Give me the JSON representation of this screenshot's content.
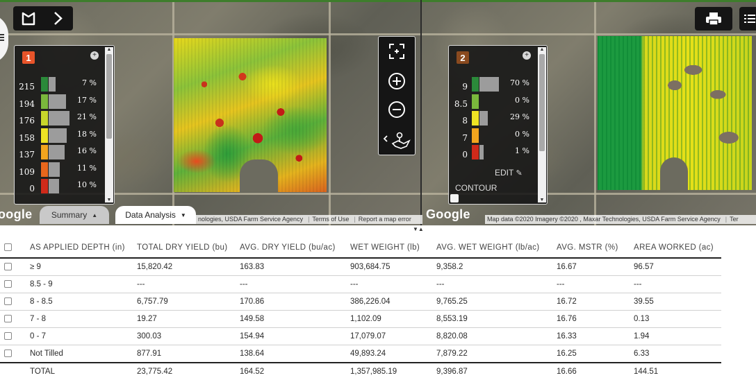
{
  "map_left": {
    "legend": {
      "badge": "1",
      "badge_color": "#e8542a",
      "rows": [
        {
          "label": "215",
          "pct": "7 %",
          "color": "#2b8a3a",
          "fraction": 0.07
        },
        {
          "label": "194",
          "pct": "17 %",
          "color": "#7ab83c",
          "fraction": 0.17
        },
        {
          "label": "176",
          "pct": "21 %",
          "color": "#c9d62b",
          "fraction": 0.21
        },
        {
          "label": "158",
          "pct": "18 %",
          "color": "#efe424",
          "fraction": 0.18
        },
        {
          "label": "137",
          "pct": "16 %",
          "color": "#f2a51e",
          "fraction": 0.16
        },
        {
          "label": "109",
          "pct": "11 %",
          "color": "#e9671c",
          "fraction": 0.11
        },
        {
          "label": "0",
          "pct": "10 %",
          "color": "#cf2a1a",
          "fraction": 0.1
        }
      ]
    },
    "google_label": "oogle",
    "tabs": {
      "summary": "Summary",
      "data_analysis": "Data Analysis"
    },
    "attribution": [
      "nologies, USDA Farm Service Agency",
      "Terms of Use",
      "Report a map error"
    ]
  },
  "map_right": {
    "legend": {
      "badge": "2",
      "badge_color": "#8a4a1f",
      "rows": [
        {
          "label": "9",
          "pct": "70 %",
          "color": "#2b8a3a",
          "fraction": 0.7
        },
        {
          "label": "8.5",
          "pct": "0 %",
          "color": "#7ab83c",
          "fraction": 0.0
        },
        {
          "label": "8",
          "pct": "29 %",
          "color": "#efe424",
          "fraction": 0.29
        },
        {
          "label": "7",
          "pct": "0 %",
          "color": "#f2a51e",
          "fraction": 0.0
        },
        {
          "label": "0",
          "pct": "1 %",
          "color": "#cf2a1a",
          "fraction": 0.01
        }
      ],
      "edit_label": "EDIT",
      "contour_label": "CONTOUR"
    },
    "google_label": "Google",
    "attribution": [
      "Map data ©2020 Imagery ©2020 , Maxar Technologies, USDA Farm Service Agency",
      "Ter"
    ]
  },
  "icons": {
    "field_icon": "field-outline-icon",
    "next_icon": "chevron-right-icon",
    "print_icon": "printer-icon",
    "list_icon": "list-icon",
    "fullscreen_icon": "fullscreen-icon",
    "zoom_in_icon": "zoom-in-icon",
    "zoom_out_icon": "zoom-out-icon",
    "layers_icon": "map-layers-icon"
  },
  "table": {
    "headers": [
      "AS APPLIED DEPTH (in)",
      "TOTAL DRY YIELD (bu)",
      "AVG. DRY YIELD (bu/ac)",
      "WET WEIGHT (lb)",
      "AVG. WET WEIGHT (lb/ac)",
      "AVG. MSTR (%)",
      "AREA WORKED (ac)"
    ],
    "rows": [
      [
        "≥ 9",
        "15,820.42",
        "163.83",
        "903,684.75",
        "9,358.2",
        "16.67",
        "96.57"
      ],
      [
        "8.5 - 9",
        "---",
        "---",
        "---",
        "---",
        "---",
        "---"
      ],
      [
        "8 - 8.5",
        "6,757.79",
        "170.86",
        "386,226.04",
        "9,765.25",
        "16.72",
        "39.55"
      ],
      [
        "7 - 8",
        "19.27",
        "149.58",
        "1,102.09",
        "8,553.19",
        "16.76",
        "0.13"
      ],
      [
        "0 - 7",
        "300.03",
        "154.94",
        "17,079.07",
        "8,820.08",
        "16.33",
        "1.94"
      ],
      [
        "Not Tilled",
        "877.91",
        "138.64",
        "49,893.24",
        "7,879.22",
        "16.25",
        "6.33"
      ]
    ],
    "total": [
      "TOTAL",
      "23,775.42",
      "164.52",
      "1,357,985.19",
      "9,396.87",
      "16.66",
      "144.51"
    ]
  }
}
